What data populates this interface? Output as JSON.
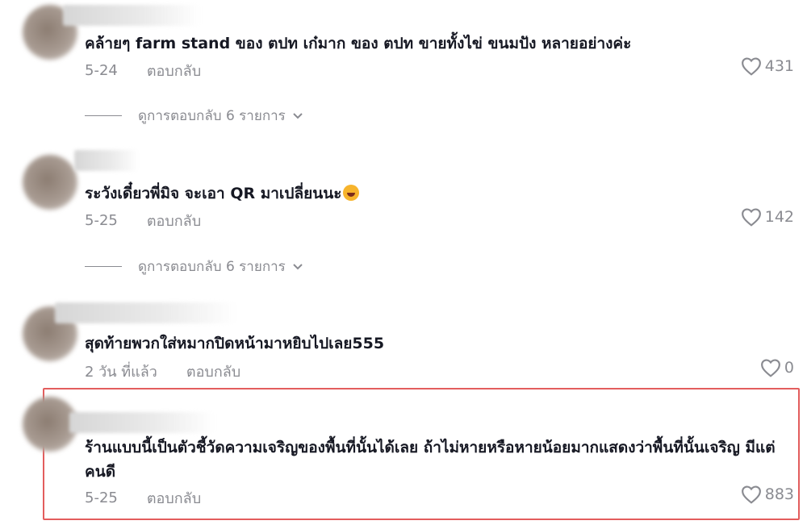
{
  "comments": [
    {
      "text": "คล้ายๆ farm stand ของ ตปท เก๋มาก ของ ตปท ขายทั้งไข่ ขนมปัง หลายอย่างค่ะ",
      "date": "5-24",
      "reply_label": "ตอบกลับ",
      "likes": "431",
      "view_replies": "ดูการตอบกลับ 6 รายการ"
    },
    {
      "text": "ระวังเดี๋ยวพี่มิจ จะเอา QR มาเปลี่ยนนะ",
      "emoji": "rolling-laughing-emoji",
      "date": "5-25",
      "reply_label": "ตอบกลับ",
      "likes": "142",
      "view_replies": "ดูการตอบกลับ 6 รายการ"
    },
    {
      "text": "สุดท้ายพวกใส่หมากปิดหน้ามาหยิบไปเลย555",
      "date": "2 วัน ที่แล้ว",
      "reply_label": "ตอบกลับ",
      "likes": "0"
    },
    {
      "text": "ร้านแบบนี้เป็นตัวชี้วัดความเจริญของพื้นที่นั้นได้เลย ถ้าไม่หายหรือหายน้อยมากแสดงว่าพื้นที่นั้นเจริญ มีแต่คนดี",
      "date": "5-25",
      "reply_label": "ตอบกลับ",
      "likes": "883",
      "highlighted": true
    }
  ],
  "colors": {
    "text": "#161823",
    "secondary": "#8a8b91",
    "highlight_border": "#e35d5d"
  },
  "icons": {
    "like": "heart-outline-icon",
    "expand": "chevron-down-icon"
  }
}
